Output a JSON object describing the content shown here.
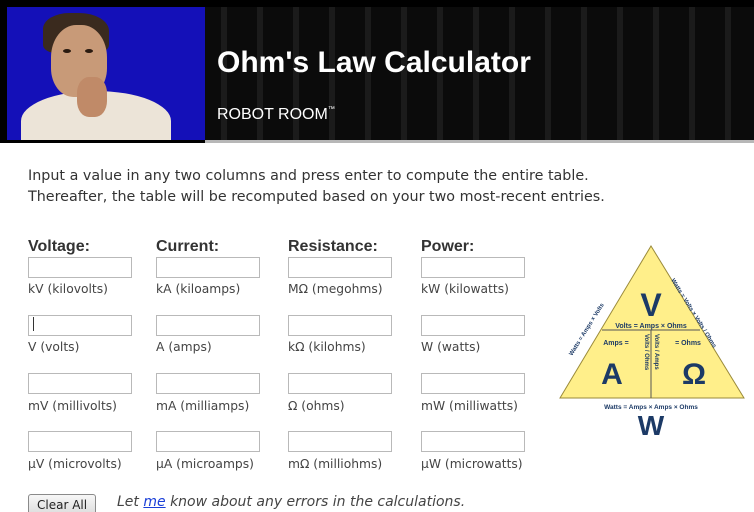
{
  "header": {
    "title": "Ohm's Law Calculator",
    "brand": "ROBOT ROOM",
    "trademark": "™"
  },
  "intro": {
    "line1": "Input a value in any two columns and press enter to compute the entire table.",
    "line2": "Thereafter, the table will be recomputed based on your two most-recent entries."
  },
  "columns": [
    {
      "heading": "Voltage:",
      "units": [
        "kV (kilovolts)",
        "V (volts)",
        "mV (millivolts)",
        "μV (microvolts)"
      ]
    },
    {
      "heading": "Current:",
      "units": [
        "kA (kiloamps)",
        "A (amps)",
        "mA (milliamps)",
        "μA (microamps)"
      ]
    },
    {
      "heading": "Resistance:",
      "units": [
        "MΩ (megohms)",
        "kΩ (kilohms)",
        "Ω (ohms)",
        "mΩ (milliohms)"
      ]
    },
    {
      "heading": "Power:",
      "units": [
        "kW (kilowatts)",
        "W (watts)",
        "mW (milliwatts)",
        "μW (microwatts)"
      ]
    }
  ],
  "triangle": {
    "top_letter": "V",
    "left_letter": "A",
    "right_letter": "Ω",
    "bottom_letter": "W",
    "mid_formula": "Volts = Amps × Ohms",
    "amps_formula": "Amps = Volts / Ohms",
    "ohms_formula": "Ohms = Volts / Amps",
    "left_side": "Watts = Amps × Volts",
    "right_side": "Watts = Volts × Volts / Ohms",
    "base_formula": "Watts = Amps × Amps × Ohms",
    "inner_amps": "Amps =",
    "inner_ohms": "= Ohms",
    "inner_vert1": "Volts / Ohms",
    "inner_vert2": "Volts / Amps",
    "fill_color": "#ffef8a",
    "letter_color": "#1c3a66"
  },
  "actions": {
    "clear_label": "Clear All",
    "note_before": "Let ",
    "note_link": "me",
    "note_after": " know about any errors in the calculations."
  }
}
